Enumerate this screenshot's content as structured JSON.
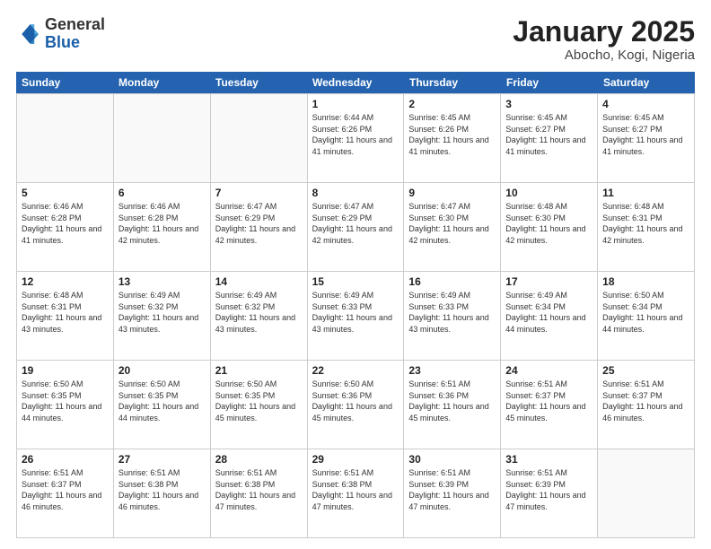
{
  "logo": {
    "general": "General",
    "blue": "Blue"
  },
  "title": "January 2025",
  "subtitle": "Abocho, Kogi, Nigeria",
  "days_of_week": [
    "Sunday",
    "Monday",
    "Tuesday",
    "Wednesday",
    "Thursday",
    "Friday",
    "Saturday"
  ],
  "weeks": [
    [
      {
        "day": "",
        "sunrise": "",
        "sunset": "",
        "daylight": "",
        "empty": true
      },
      {
        "day": "",
        "sunrise": "",
        "sunset": "",
        "daylight": "",
        "empty": true
      },
      {
        "day": "",
        "sunrise": "",
        "sunset": "",
        "daylight": "",
        "empty": true
      },
      {
        "day": "1",
        "sunrise": "Sunrise: 6:44 AM",
        "sunset": "Sunset: 6:26 PM",
        "daylight": "Daylight: 11 hours and 41 minutes."
      },
      {
        "day": "2",
        "sunrise": "Sunrise: 6:45 AM",
        "sunset": "Sunset: 6:26 PM",
        "daylight": "Daylight: 11 hours and 41 minutes."
      },
      {
        "day": "3",
        "sunrise": "Sunrise: 6:45 AM",
        "sunset": "Sunset: 6:27 PM",
        "daylight": "Daylight: 11 hours and 41 minutes."
      },
      {
        "day": "4",
        "sunrise": "Sunrise: 6:45 AM",
        "sunset": "Sunset: 6:27 PM",
        "daylight": "Daylight: 11 hours and 41 minutes."
      }
    ],
    [
      {
        "day": "5",
        "sunrise": "Sunrise: 6:46 AM",
        "sunset": "Sunset: 6:28 PM",
        "daylight": "Daylight: 11 hours and 41 minutes."
      },
      {
        "day": "6",
        "sunrise": "Sunrise: 6:46 AM",
        "sunset": "Sunset: 6:28 PM",
        "daylight": "Daylight: 11 hours and 42 minutes."
      },
      {
        "day": "7",
        "sunrise": "Sunrise: 6:47 AM",
        "sunset": "Sunset: 6:29 PM",
        "daylight": "Daylight: 11 hours and 42 minutes."
      },
      {
        "day": "8",
        "sunrise": "Sunrise: 6:47 AM",
        "sunset": "Sunset: 6:29 PM",
        "daylight": "Daylight: 11 hours and 42 minutes."
      },
      {
        "day": "9",
        "sunrise": "Sunrise: 6:47 AM",
        "sunset": "Sunset: 6:30 PM",
        "daylight": "Daylight: 11 hours and 42 minutes."
      },
      {
        "day": "10",
        "sunrise": "Sunrise: 6:48 AM",
        "sunset": "Sunset: 6:30 PM",
        "daylight": "Daylight: 11 hours and 42 minutes."
      },
      {
        "day": "11",
        "sunrise": "Sunrise: 6:48 AM",
        "sunset": "Sunset: 6:31 PM",
        "daylight": "Daylight: 11 hours and 42 minutes."
      }
    ],
    [
      {
        "day": "12",
        "sunrise": "Sunrise: 6:48 AM",
        "sunset": "Sunset: 6:31 PM",
        "daylight": "Daylight: 11 hours and 43 minutes."
      },
      {
        "day": "13",
        "sunrise": "Sunrise: 6:49 AM",
        "sunset": "Sunset: 6:32 PM",
        "daylight": "Daylight: 11 hours and 43 minutes."
      },
      {
        "day": "14",
        "sunrise": "Sunrise: 6:49 AM",
        "sunset": "Sunset: 6:32 PM",
        "daylight": "Daylight: 11 hours and 43 minutes."
      },
      {
        "day": "15",
        "sunrise": "Sunrise: 6:49 AM",
        "sunset": "Sunset: 6:33 PM",
        "daylight": "Daylight: 11 hours and 43 minutes."
      },
      {
        "day": "16",
        "sunrise": "Sunrise: 6:49 AM",
        "sunset": "Sunset: 6:33 PM",
        "daylight": "Daylight: 11 hours and 43 minutes."
      },
      {
        "day": "17",
        "sunrise": "Sunrise: 6:49 AM",
        "sunset": "Sunset: 6:34 PM",
        "daylight": "Daylight: 11 hours and 44 minutes."
      },
      {
        "day": "18",
        "sunrise": "Sunrise: 6:50 AM",
        "sunset": "Sunset: 6:34 PM",
        "daylight": "Daylight: 11 hours and 44 minutes."
      }
    ],
    [
      {
        "day": "19",
        "sunrise": "Sunrise: 6:50 AM",
        "sunset": "Sunset: 6:35 PM",
        "daylight": "Daylight: 11 hours and 44 minutes."
      },
      {
        "day": "20",
        "sunrise": "Sunrise: 6:50 AM",
        "sunset": "Sunset: 6:35 PM",
        "daylight": "Daylight: 11 hours and 44 minutes."
      },
      {
        "day": "21",
        "sunrise": "Sunrise: 6:50 AM",
        "sunset": "Sunset: 6:35 PM",
        "daylight": "Daylight: 11 hours and 45 minutes."
      },
      {
        "day": "22",
        "sunrise": "Sunrise: 6:50 AM",
        "sunset": "Sunset: 6:36 PM",
        "daylight": "Daylight: 11 hours and 45 minutes."
      },
      {
        "day": "23",
        "sunrise": "Sunrise: 6:51 AM",
        "sunset": "Sunset: 6:36 PM",
        "daylight": "Daylight: 11 hours and 45 minutes."
      },
      {
        "day": "24",
        "sunrise": "Sunrise: 6:51 AM",
        "sunset": "Sunset: 6:37 PM",
        "daylight": "Daylight: 11 hours and 45 minutes."
      },
      {
        "day": "25",
        "sunrise": "Sunrise: 6:51 AM",
        "sunset": "Sunset: 6:37 PM",
        "daylight": "Daylight: 11 hours and 46 minutes."
      }
    ],
    [
      {
        "day": "26",
        "sunrise": "Sunrise: 6:51 AM",
        "sunset": "Sunset: 6:37 PM",
        "daylight": "Daylight: 11 hours and 46 minutes."
      },
      {
        "day": "27",
        "sunrise": "Sunrise: 6:51 AM",
        "sunset": "Sunset: 6:38 PM",
        "daylight": "Daylight: 11 hours and 46 minutes."
      },
      {
        "day": "28",
        "sunrise": "Sunrise: 6:51 AM",
        "sunset": "Sunset: 6:38 PM",
        "daylight": "Daylight: 11 hours and 47 minutes."
      },
      {
        "day": "29",
        "sunrise": "Sunrise: 6:51 AM",
        "sunset": "Sunset: 6:38 PM",
        "daylight": "Daylight: 11 hours and 47 minutes."
      },
      {
        "day": "30",
        "sunrise": "Sunrise: 6:51 AM",
        "sunset": "Sunset: 6:39 PM",
        "daylight": "Daylight: 11 hours and 47 minutes."
      },
      {
        "day": "31",
        "sunrise": "Sunrise: 6:51 AM",
        "sunset": "Sunset: 6:39 PM",
        "daylight": "Daylight: 11 hours and 47 minutes."
      },
      {
        "day": "",
        "sunrise": "",
        "sunset": "",
        "daylight": "",
        "empty": true
      }
    ]
  ]
}
